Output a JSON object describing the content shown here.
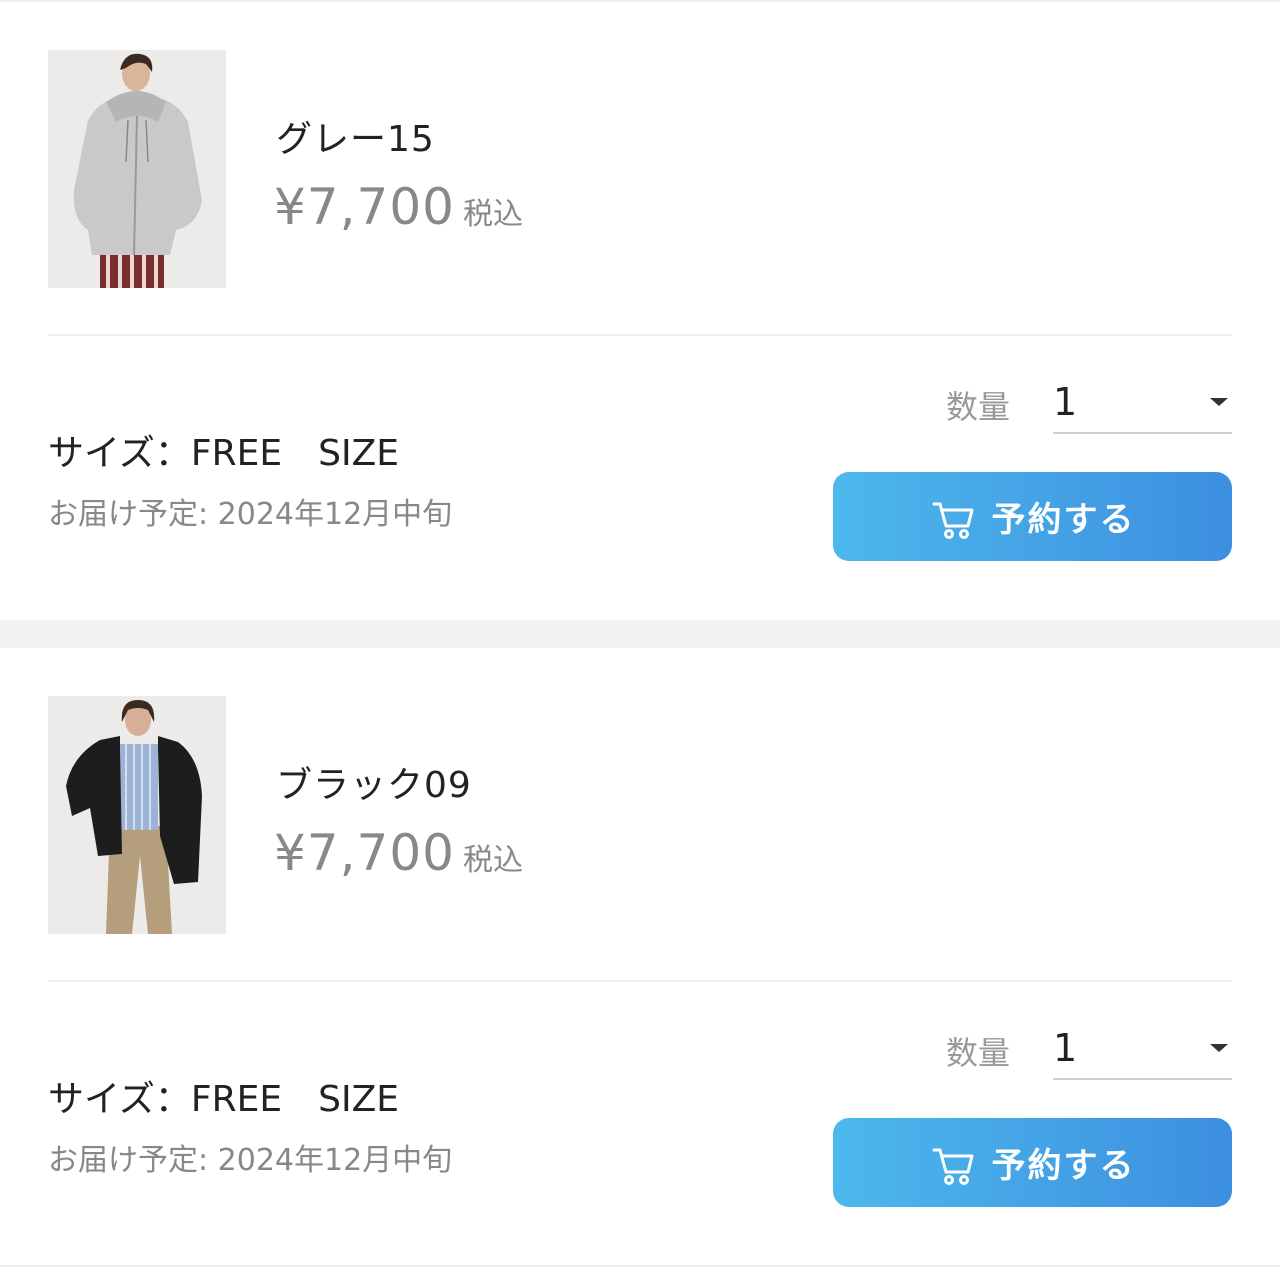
{
  "items": [
    {
      "color_name": "グレー15",
      "price": "¥7,700",
      "tax_label": "税込",
      "size": "サイズ：FREE　SIZE",
      "delivery": "お届け予定: 2024年12月中旬",
      "quantity_label": "数量",
      "quantity_value": "1",
      "reserve_label": "予約する",
      "image": "model-gray-zip-hoodie-photo"
    },
    {
      "color_name": "ブラック09",
      "price": "¥7,700",
      "tax_label": "税込",
      "size": "サイズ：FREE　SIZE",
      "delivery": "お届け予定: 2024年12月中旬",
      "quantity_label": "数量",
      "quantity_value": "1",
      "reserve_label": "予約する",
      "image": "model-black-zip-hoodie-photo"
    }
  ],
  "icons": {
    "cart": "cart-icon",
    "dropdown": "chevron-down-icon"
  },
  "colors": {
    "button_gradient_start": "#4cb8ec",
    "button_gradient_end": "#3d8fe0",
    "muted_text": "#888888"
  }
}
